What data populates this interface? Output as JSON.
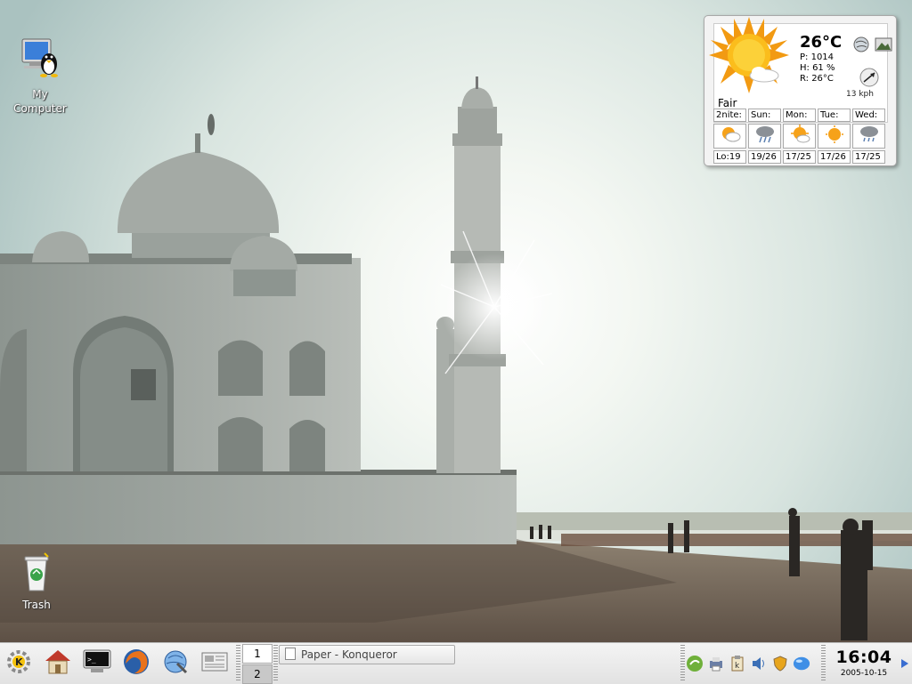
{
  "desktop": {
    "icons": [
      {
        "label": "My\nComputer",
        "line1": "My",
        "line2": "Computer",
        "icon": "computer-icon"
      },
      {
        "label": "Trash",
        "icon": "trash-icon"
      }
    ]
  },
  "weather": {
    "temperature": "26°C",
    "pressure": "P: 1014",
    "humidity": "H: 61 %",
    "realfeel": "R: 26°C",
    "condition": "Fair",
    "wind": "13 kph",
    "forecast": [
      {
        "day": "2nite:",
        "low_high": "Lo:19",
        "icon": "partly-cloudy-night-icon"
      },
      {
        "day": "Sun:",
        "low_high": "19/26",
        "icon": "thunderstorm-icon"
      },
      {
        "day": "Mon:",
        "low_high": "17/25",
        "icon": "sun-cloud-icon"
      },
      {
        "day": "Tue:",
        "low_high": "17/26",
        "icon": "sun-icon"
      },
      {
        "day": "Wed:",
        "low_high": "17/25",
        "icon": "rain-icon"
      }
    ]
  },
  "taskbar": {
    "launchers": [
      "kde-menu-icon",
      "home-icon",
      "terminal-icon",
      "firefox-icon",
      "konqueror-icon",
      "newspaper-icon"
    ],
    "pager": [
      "1",
      "2"
    ],
    "tasks": [
      {
        "label": "Paper - Konqueror",
        "icon": "document-icon"
      }
    ],
    "tray": [
      "green-leaf-icon",
      "network-printer-icon",
      "klipper-icon",
      "volume-icon",
      "shield-icon",
      "globe-icon"
    ],
    "clock_time": "16:04",
    "clock_date": "2005-10-15"
  },
  "colors": {
    "taskbar_bg": "#e6e6e6",
    "accent": "#3a6ed1",
    "sun": "#f7a51b"
  }
}
